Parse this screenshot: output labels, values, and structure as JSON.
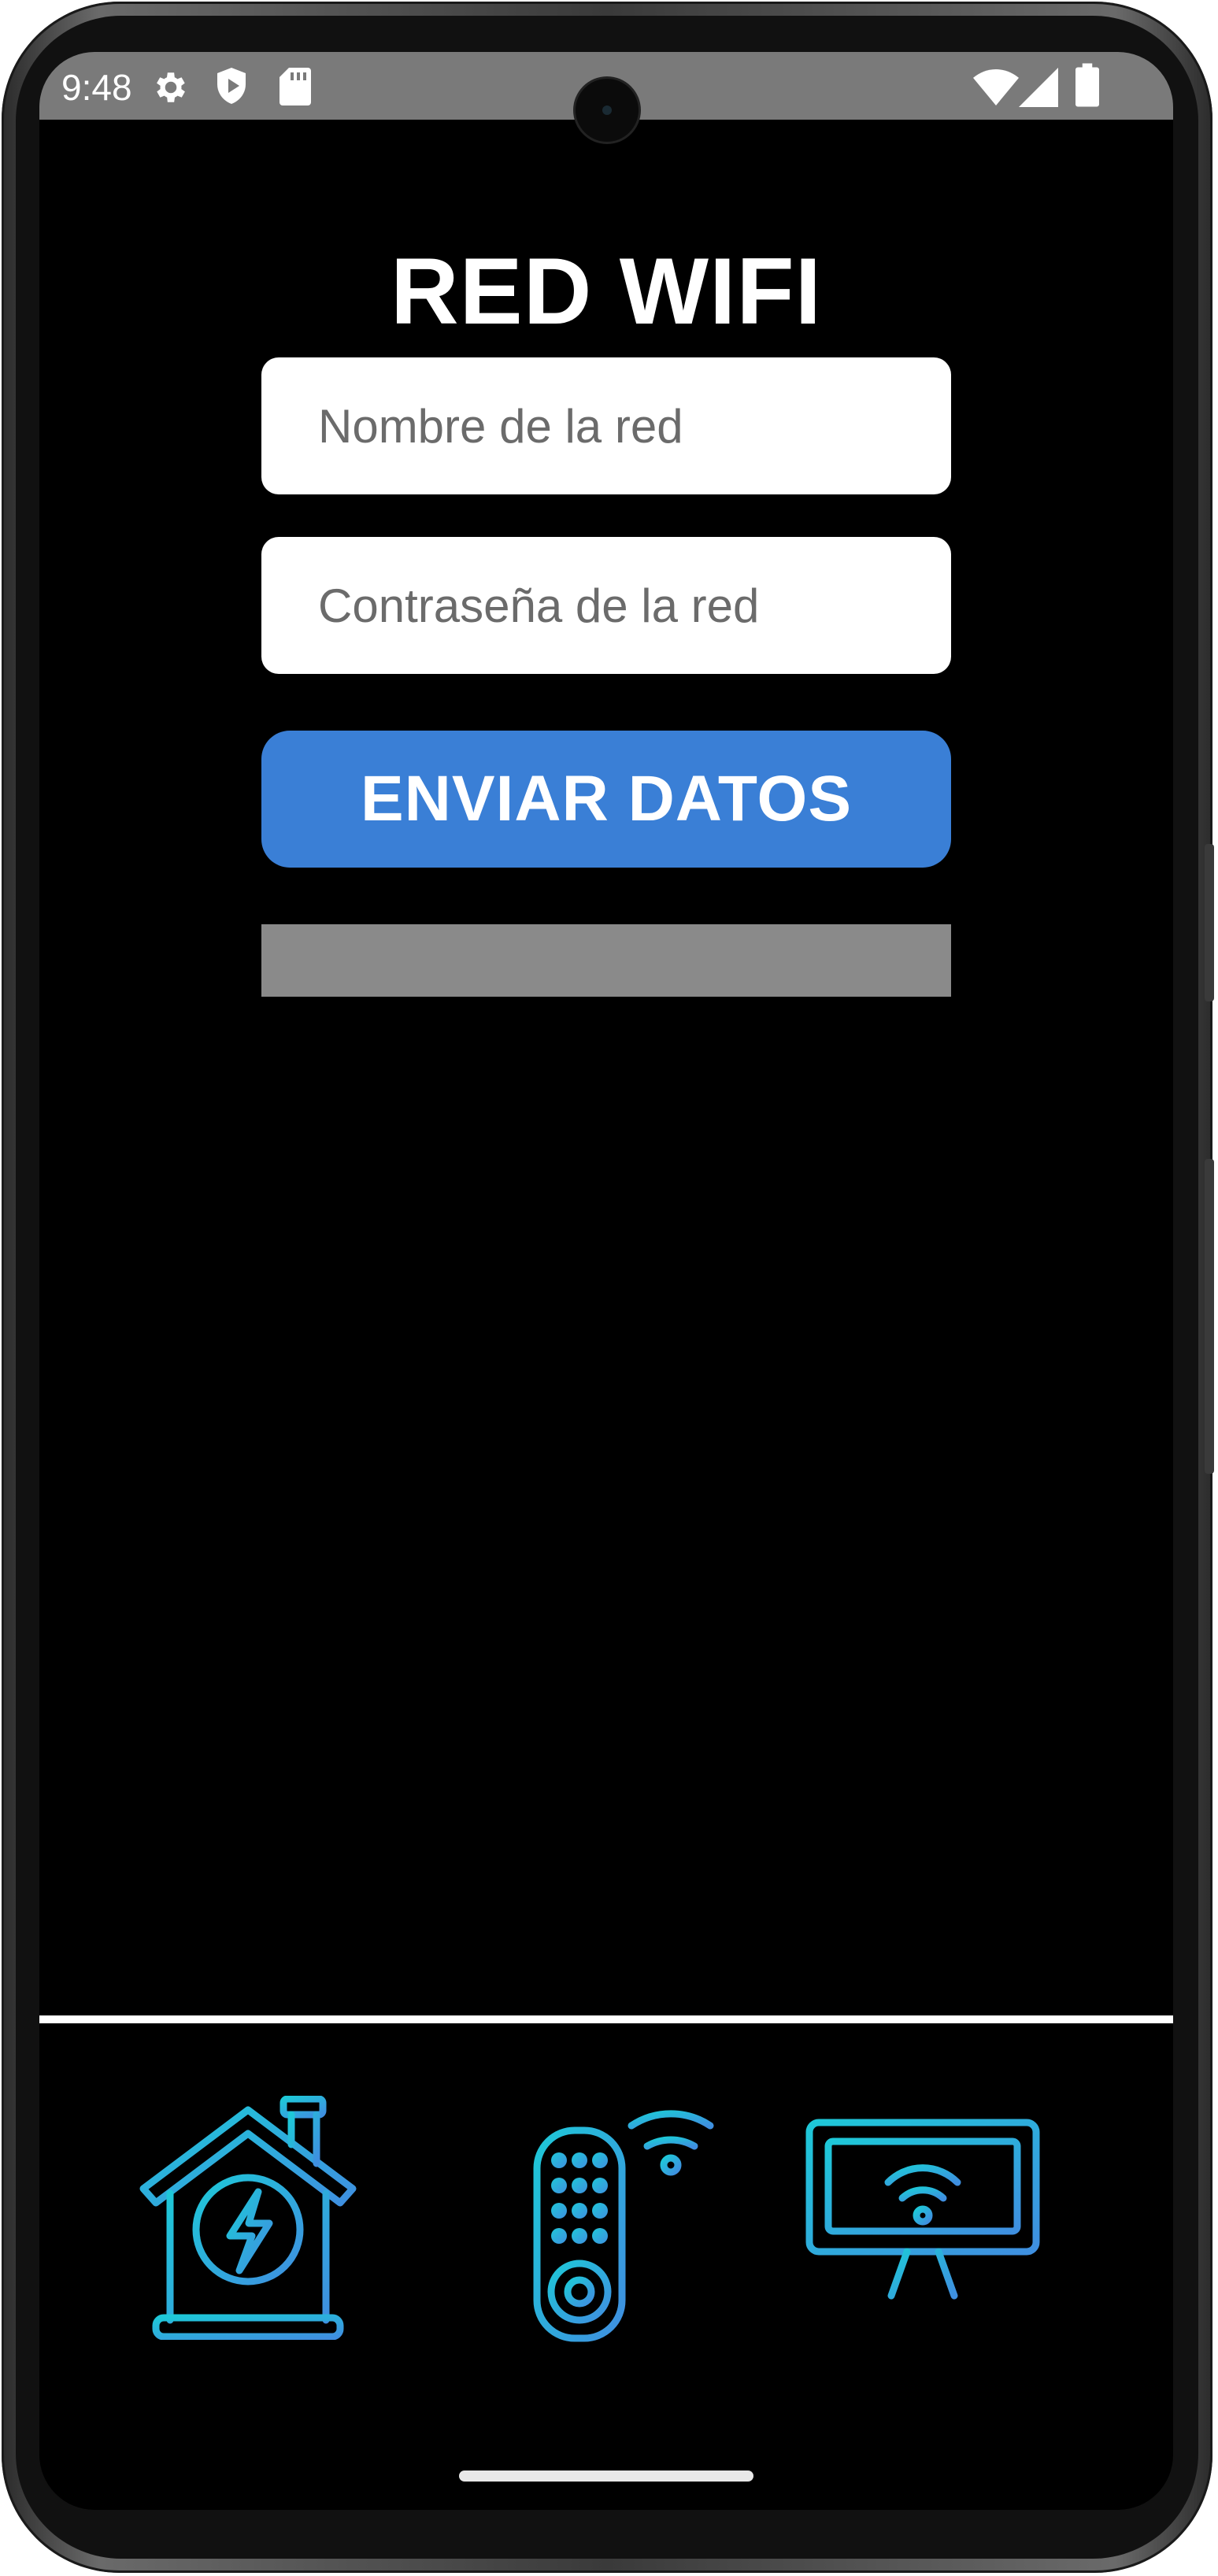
{
  "status_bar": {
    "time": "9:48",
    "left_icons": [
      "gear-icon",
      "shield-play-icon",
      "sd-card-icon"
    ],
    "right_icons": [
      "wifi-icon",
      "signal-icon",
      "battery-icon"
    ]
  },
  "page": {
    "title": "RED WIFI"
  },
  "form": {
    "network_name_placeholder": "Nombre de la red",
    "network_password_placeholder": "Contraseña de la red",
    "send_button_label": "ENVIAR DATOS",
    "status_text": ""
  },
  "bottom_nav": {
    "items": [
      {
        "name": "smart-home-energy-icon"
      },
      {
        "name": "wifi-remote-control-icon"
      },
      {
        "name": "wifi-monitor-icon"
      }
    ]
  },
  "colors": {
    "background": "#000000",
    "accent": "#3a7fd6",
    "icon_gradient_start": "#1ec8d8",
    "icon_gradient_end": "#3f8fe0",
    "status_box": "#8a8a8a"
  }
}
